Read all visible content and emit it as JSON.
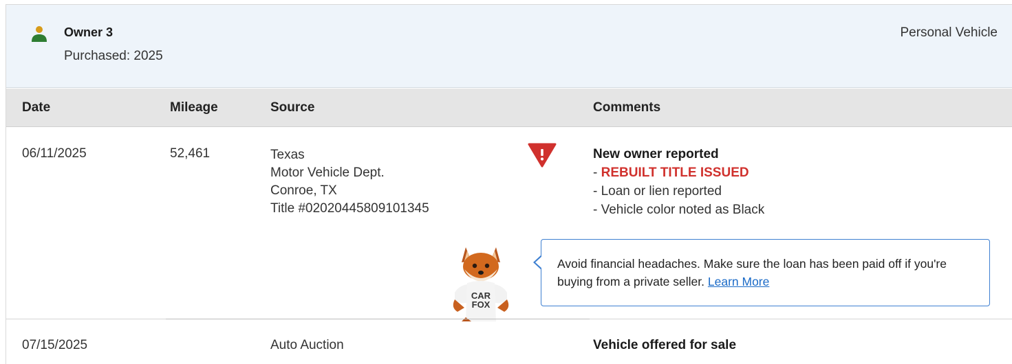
{
  "owner": {
    "name": "Owner 3",
    "purchased": "Purchased: 2025",
    "vehicle_type": "Personal Vehicle",
    "icon": "person-icon",
    "icon_colors": {
      "head": "#d79b1a",
      "body": "#2e7d32"
    }
  },
  "table": {
    "headers": {
      "date": "Date",
      "mileage": "Mileage",
      "source": "Source",
      "comments": "Comments"
    },
    "rows": [
      {
        "date": "06/11/2025",
        "mileage": "52,461",
        "source": [
          "Texas",
          "Motor Vehicle Dept.",
          "Conroe, TX",
          "Title #02020445809101345"
        ],
        "alert_icon": "warning-shield-icon",
        "comment_title": "New owner reported",
        "comment_items": [
          {
            "prefix": "- ",
            "text": "REBUILT TITLE ISSUED",
            "highlight": true
          },
          {
            "prefix": "- ",
            "text": "Loan or lien reported",
            "highlight": false
          },
          {
            "prefix": "- ",
            "text": "Vehicle color noted as Black",
            "highlight": false
          }
        ],
        "tip": {
          "text": "Avoid financial headaches. Make sure the loan has been paid off if you're buying from a private seller.",
          "link": "Learn More",
          "mascot_shirt_line1": "CAR",
          "mascot_shirt_line2": "FOX"
        }
      },
      {
        "date": "07/15/2025",
        "mileage": "",
        "source": [
          "Auto Auction"
        ],
        "comment_title": "Vehicle offered for sale"
      }
    ]
  },
  "colors": {
    "header_bg": "#eef4fa",
    "table_head_bg": "#e5e5e5",
    "alert_red": "#d0312d",
    "tip_border": "#3d7fd1",
    "link": "#1a6ac7"
  }
}
